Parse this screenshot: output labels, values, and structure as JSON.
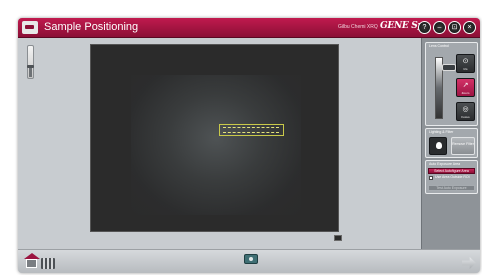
{
  "window": {
    "title": "Sample Positioning",
    "instrument": "Gilbu Chemi XRQ",
    "brand": "GENE Sys",
    "controls": [
      "?",
      "–",
      "⊡",
      "×"
    ]
  },
  "zoom": {
    "level_fraction": 0.3
  },
  "focus": {
    "level_fraction": 0.1
  },
  "side_panel": {
    "lens_control": {
      "title": "Lens Control",
      "buttons": [
        {
          "glyph": "⊙",
          "label": "Iris"
        },
        {
          "glyph": "↗",
          "label": "Zoom"
        },
        {
          "glyph": "◎",
          "label": "Focus"
        }
      ]
    },
    "lighting": {
      "title": "Lighting & Filter",
      "remove_filter_label": "Remove Filter"
    },
    "auto_exposure": {
      "title": "Auto Exposure Area",
      "select_button_label": "Select Autofigure Area",
      "checkbox_label": "Use Area Outside ROI",
      "checkbox_checked": false,
      "test_button_label": "Test Auto Exposure"
    }
  },
  "colors": {
    "titlebar": "#a3123f",
    "accent": "#c8245a",
    "panel": "#8e9398",
    "viewer_bg": "#2b2b2b"
  },
  "icons": {
    "app": "monitor-icon",
    "home": "home-icon",
    "tools": "tools-icon",
    "camera": "camera-icon",
    "next": "arrow-right-icon",
    "snapshot": "snapshot-icon"
  }
}
